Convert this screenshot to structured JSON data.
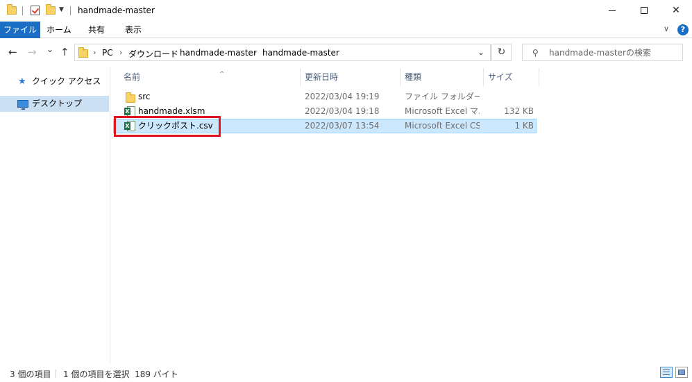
{
  "window": {
    "title": "handmade-master",
    "minimize_icon": "minimize-icon",
    "maximize_icon": "maximize-icon",
    "close_glyph": "✕"
  },
  "ribbon": {
    "tabs": [
      {
        "label": "ファイル",
        "active": true
      },
      {
        "label": "ホーム"
      },
      {
        "label": "共有"
      },
      {
        "label": "表示"
      }
    ],
    "expand_glyph": "∨",
    "help_glyph": "?"
  },
  "nav_buttons": {
    "back": "←",
    "forward": "→",
    "recent": "⌄",
    "up": "↑"
  },
  "address": {
    "crumbs": [
      "PC",
      "ダウンロード",
      "handmade-master",
      "handmade-master"
    ],
    "separator": "›",
    "dropdown_glyph": "⌄",
    "refresh_glyph": "↻"
  },
  "search": {
    "placeholder": "handmade-masterの検索",
    "icon_glyph": "⚲"
  },
  "nav_pane": {
    "items": [
      {
        "label": "クイック アクセス",
        "icon": "star-icon"
      },
      {
        "label": "デスクトップ",
        "icon": "desktop-icon",
        "selected": true
      }
    ]
  },
  "columns": {
    "name": "名前",
    "date": "更新日時",
    "type": "種類",
    "size": "サイズ",
    "sort_glyph": "^"
  },
  "files": [
    {
      "name": "src",
      "date": "2022/03/04 19:19",
      "type": "ファイル フォルダー",
      "size": "",
      "icon": "folder-icon"
    },
    {
      "name": "handmade.xlsm",
      "date": "2022/03/04 19:18",
      "type": "Microsoft Excel マ...",
      "size": "132 KB",
      "icon": "excel-macro-icon"
    },
    {
      "name": "クリックポスト.csv",
      "date": "2022/03/07 13:54",
      "type": "Microsoft Excel CS...",
      "size": "1 KB",
      "icon": "excel-csv-icon",
      "selected": true
    }
  ],
  "status": {
    "item_count": "3 個の項目",
    "selection": "1 個の項目を選択  189 バイト"
  },
  "colors": {
    "accent": "#1a6fc5",
    "highlight": "#e0161f",
    "selection": "#cce8ff"
  }
}
